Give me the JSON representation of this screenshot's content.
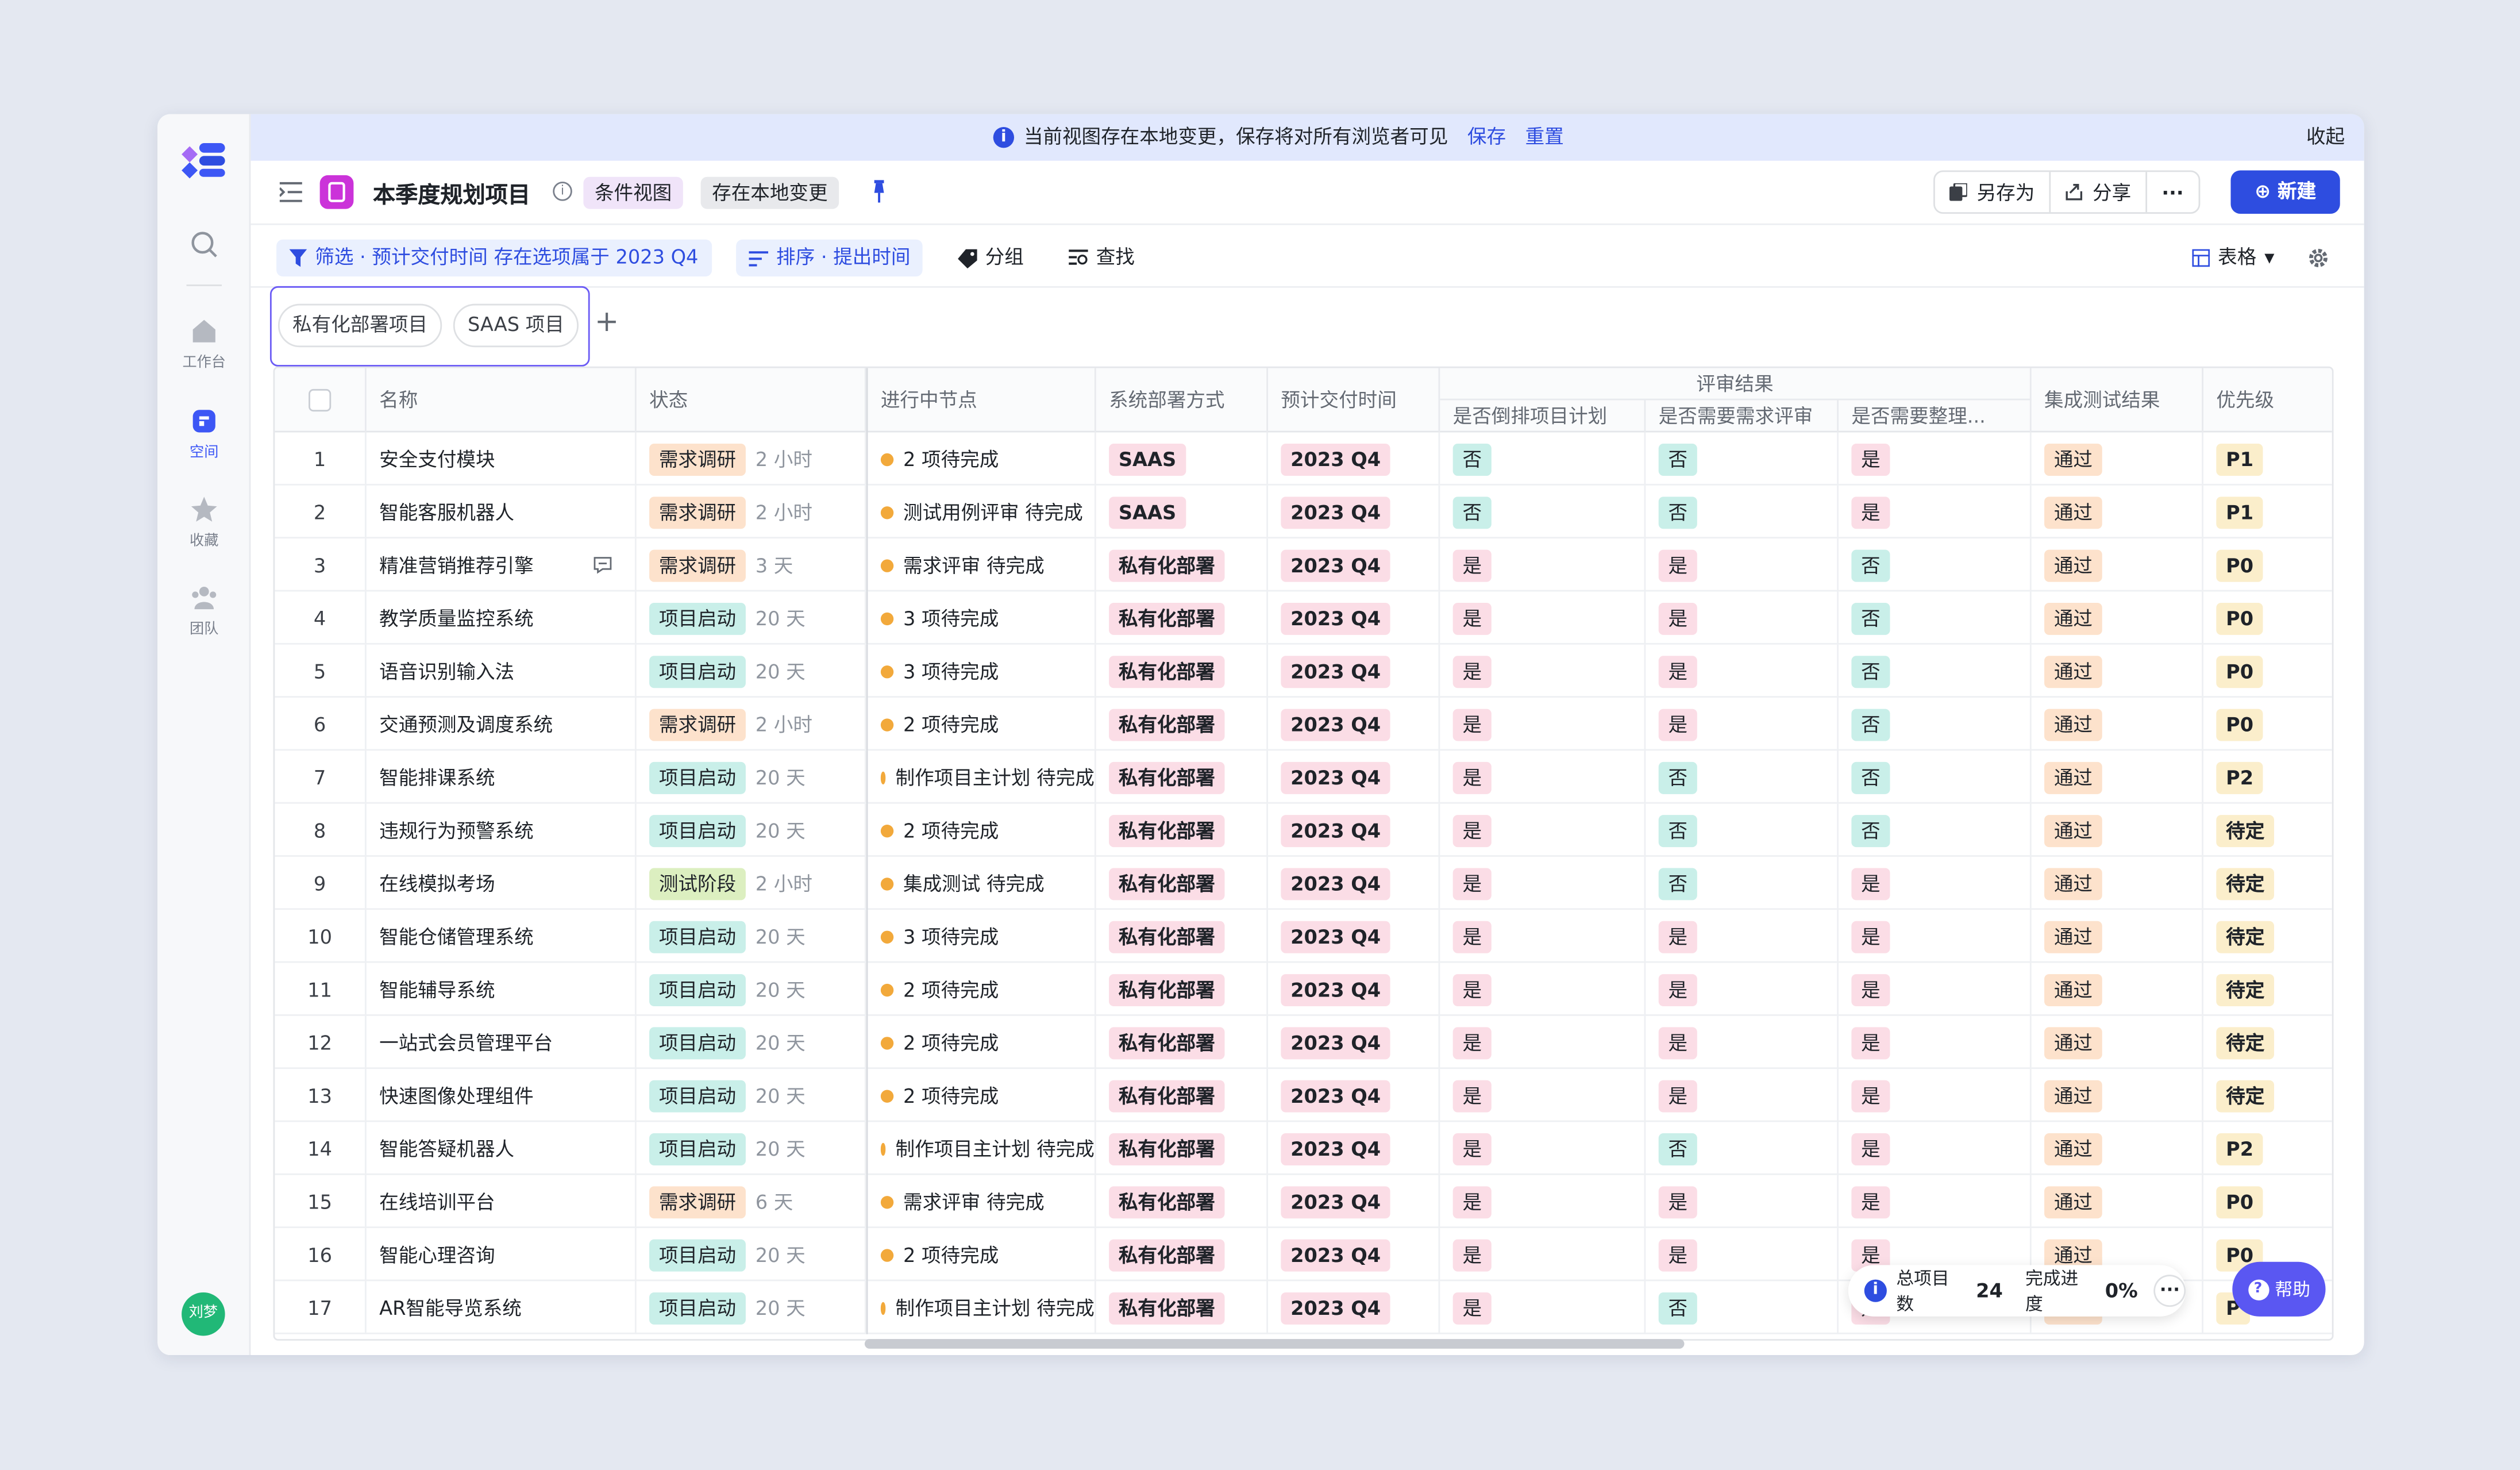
{
  "banner": {
    "message": "当前视图存在本地变更，保存将对所有浏览者可见",
    "save": "保存",
    "reset": "重置",
    "collapse": "收起"
  },
  "sidebar": {
    "items": [
      {
        "label": "工作台",
        "icon": "home-icon"
      },
      {
        "label": "空间",
        "icon": "space-icon"
      },
      {
        "label": "收藏",
        "icon": "star-icon"
      },
      {
        "label": "团队",
        "icon": "team-icon"
      }
    ],
    "avatar": "刘梦"
  },
  "header": {
    "title": "本季度规划项目",
    "tag1": "条件视图",
    "tag2": "存在本地变更",
    "save_as": "另存为",
    "share": "分享",
    "more": "···",
    "new": "新建"
  },
  "toolbar": {
    "filter": "筛选 · 预计交付时间 存在选项属于 2023 Q4",
    "sort": "排序 · 提出时间",
    "group": "分组",
    "find": "查找",
    "view": "表格"
  },
  "view_tabs": [
    "私有化部署项目",
    "SAAS 项目"
  ],
  "columns": {
    "name": "名称",
    "status": "状态",
    "node": "进行中节点",
    "deploy": "系统部署方式",
    "delivery": "预计交付时间",
    "review": "评审结果",
    "review_sub": [
      "是否倒排项目计划",
      "是否需要需求评审",
      "是否需要整理..."
    ],
    "integration": "集成测试结果",
    "priority": "优先级"
  },
  "rows": [
    {
      "n": "1",
      "name": "安全支付模块",
      "status": "需求调研",
      "dur": "2 小时",
      "node": "2 项待完成",
      "deploy": "SAAS",
      "delivery": "2023 Q4",
      "r1": "否",
      "r2": "否",
      "r3": "是",
      "test": "通过",
      "pri": "P1"
    },
    {
      "n": "2",
      "name": "智能客服机器人",
      "status": "需求调研",
      "dur": "2 小时",
      "node": "测试用例评审 待完成",
      "deploy": "SAAS",
      "delivery": "2023 Q4",
      "r1": "否",
      "r2": "否",
      "r3": "是",
      "test": "通过",
      "pri": "P1"
    },
    {
      "n": "3",
      "name": "精准营销推荐引擎",
      "status": "需求调研",
      "dur": "3 天",
      "node": "需求评审 待完成",
      "deploy": "私有化部署",
      "delivery": "2023 Q4",
      "r1": "是",
      "r2": "是",
      "r3": "否",
      "test": "通过",
      "pri": "P0",
      "comment": true
    },
    {
      "n": "4",
      "name": "教学质量监控系统",
      "status": "项目启动",
      "dur": "20 天",
      "node": "3 项待完成",
      "deploy": "私有化部署",
      "delivery": "2023 Q4",
      "r1": "是",
      "r2": "是",
      "r3": "否",
      "test": "通过",
      "pri": "P0"
    },
    {
      "n": "5",
      "name": "语音识别输入法",
      "status": "项目启动",
      "dur": "20 天",
      "node": "3 项待完成",
      "deploy": "私有化部署",
      "delivery": "2023 Q4",
      "r1": "是",
      "r2": "是",
      "r3": "否",
      "test": "通过",
      "pri": "P0"
    },
    {
      "n": "6",
      "name": "交通预测及调度系统",
      "status": "需求调研",
      "dur": "2 小时",
      "node": "2 项待完成",
      "deploy": "私有化部署",
      "delivery": "2023 Q4",
      "r1": "是",
      "r2": "是",
      "r3": "否",
      "test": "通过",
      "pri": "P0"
    },
    {
      "n": "7",
      "name": "智能排课系统",
      "status": "项目启动",
      "dur": "20 天",
      "node": "制作项目主计划 待完成",
      "deploy": "私有化部署",
      "delivery": "2023 Q4",
      "r1": "是",
      "r2": "否",
      "r3": "否",
      "test": "通过",
      "pri": "P2"
    },
    {
      "n": "8",
      "name": "违规行为预警系统",
      "status": "项目启动",
      "dur": "20 天",
      "node": "2 项待完成",
      "deploy": "私有化部署",
      "delivery": "2023 Q4",
      "r1": "是",
      "r2": "否",
      "r3": "否",
      "test": "通过",
      "pri": "待定"
    },
    {
      "n": "9",
      "name": "在线模拟考场",
      "status": "测试阶段",
      "dur": "2 小时",
      "node": "集成测试 待完成",
      "deploy": "私有化部署",
      "delivery": "2023 Q4",
      "r1": "是",
      "r2": "否",
      "r3": "是",
      "test": "通过",
      "pri": "待定"
    },
    {
      "n": "10",
      "name": "智能仓储管理系统",
      "status": "项目启动",
      "dur": "20 天",
      "node": "3 项待完成",
      "deploy": "私有化部署",
      "delivery": "2023 Q4",
      "r1": "是",
      "r2": "是",
      "r3": "是",
      "test": "通过",
      "pri": "待定"
    },
    {
      "n": "11",
      "name": "智能辅导系统",
      "status": "项目启动",
      "dur": "20 天",
      "node": "2 项待完成",
      "deploy": "私有化部署",
      "delivery": "2023 Q4",
      "r1": "是",
      "r2": "是",
      "r3": "是",
      "test": "通过",
      "pri": "待定"
    },
    {
      "n": "12",
      "name": "一站式会员管理平台",
      "status": "项目启动",
      "dur": "20 天",
      "node": "2 项待完成",
      "deploy": "私有化部署",
      "delivery": "2023 Q4",
      "r1": "是",
      "r2": "是",
      "r3": "是",
      "test": "通过",
      "pri": "待定"
    },
    {
      "n": "13",
      "name": "快速图像处理组件",
      "status": "项目启动",
      "dur": "20 天",
      "node": "2 项待完成",
      "deploy": "私有化部署",
      "delivery": "2023 Q4",
      "r1": "是",
      "r2": "是",
      "r3": "是",
      "test": "通过",
      "pri": "待定"
    },
    {
      "n": "14",
      "name": "智能答疑机器人",
      "status": "项目启动",
      "dur": "20 天",
      "node": "制作项目主计划 待完成",
      "deploy": "私有化部署",
      "delivery": "2023 Q4",
      "r1": "是",
      "r2": "否",
      "r3": "是",
      "test": "通过",
      "pri": "P2"
    },
    {
      "n": "15",
      "name": "在线培训平台",
      "status": "需求调研",
      "dur": "6 天",
      "node": "需求评审 待完成",
      "deploy": "私有化部署",
      "delivery": "2023 Q4",
      "r1": "是",
      "r2": "是",
      "r3": "是",
      "test": "通过",
      "pri": "P0"
    },
    {
      "n": "16",
      "name": "智能心理咨询",
      "status": "项目启动",
      "dur": "20 天",
      "node": "2 项待完成",
      "deploy": "私有化部署",
      "delivery": "2023 Q4",
      "r1": "是",
      "r2": "是",
      "r3": "是",
      "test": "通过",
      "pri": "P0"
    },
    {
      "n": "17",
      "name": "AR智能导览系统",
      "status": "项目启动",
      "dur": "20 天",
      "node": "制作项目主计划 待完成",
      "deploy": "私有化部署",
      "delivery": "2023 Q4",
      "r1": "是",
      "r2": "否",
      "r3": "是",
      "test": "通过",
      "pri": "P"
    }
  ],
  "footer": {
    "total_label": "总项目数",
    "total": "24",
    "progress_label": "完成进度",
    "progress": "0%",
    "more": "···"
  },
  "help": "帮助",
  "colors": {
    "accent": "#2e4de0",
    "status_research": "#fde2cc",
    "status_start": "#c9efe9",
    "status_test": "#dcefc0",
    "deploy": "#fbdde6",
    "yes": "#fbdde6",
    "no": "#c9efe9",
    "test_pass": "#fde2cc",
    "priority": "#fbeecb"
  }
}
